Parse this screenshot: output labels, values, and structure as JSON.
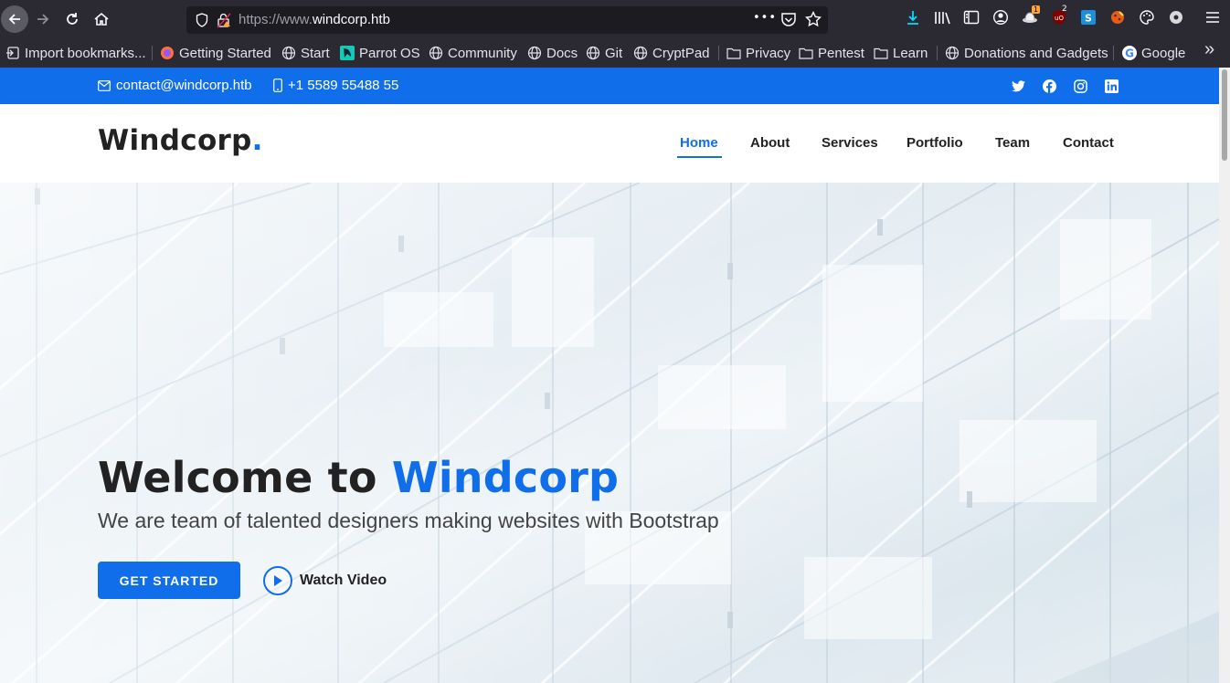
{
  "browser": {
    "url_prefix": "https://www.",
    "url_domain": "windcorp.htb",
    "page_actions_glyph": "•••",
    "bookmarks": [
      {
        "label": "Import bookmarks...",
        "icon": "import-icon"
      },
      {
        "label": "Getting Started",
        "icon": "firefox-icon"
      },
      {
        "label": "Start",
        "icon": "globe-icon"
      },
      {
        "label": "Parrot OS",
        "icon": "parrot-icon"
      },
      {
        "label": "Community",
        "icon": "globe-icon"
      },
      {
        "label": "Docs",
        "icon": "globe-icon"
      },
      {
        "label": "Git",
        "icon": "globe-icon"
      },
      {
        "label": "CryptPad",
        "icon": "globe-icon"
      },
      {
        "label": "Privacy",
        "icon": "folder-icon"
      },
      {
        "label": "Pentest",
        "icon": "folder-icon"
      },
      {
        "label": "Learn",
        "icon": "folder-icon"
      },
      {
        "label": "Donations and Gadgets",
        "icon": "globe-icon"
      },
      {
        "label": "Google",
        "icon": "google-icon"
      }
    ],
    "extension_badges": {
      "first": "1",
      "second": "2"
    },
    "overflow_glyph": "»"
  },
  "topbar": {
    "email": "contact@windcorp.htb",
    "phone": "+1 5589 55488 55",
    "socials": [
      "twitter-icon",
      "facebook-icon",
      "instagram-icon",
      "linkedin-icon"
    ]
  },
  "header": {
    "logo_text": "Windcorp",
    "logo_dot": ".",
    "nav": [
      {
        "label": "Home",
        "active": true
      },
      {
        "label": "About",
        "active": false
      },
      {
        "label": "Services",
        "active": false
      },
      {
        "label": "Portfolio",
        "active": false
      },
      {
        "label": "Team",
        "active": false
      },
      {
        "label": "Contact",
        "active": false
      }
    ]
  },
  "hero": {
    "title_lead": "Welcome to ",
    "title_brand": "Windcorp",
    "subtitle": "We are team of talented designers making websites with Bootstrap",
    "cta_label": "GET STARTED",
    "video_label": "Watch Video"
  },
  "colors": {
    "accent": "#106eea",
    "browser_bg": "#2b2a33",
    "heading": "#222222"
  }
}
